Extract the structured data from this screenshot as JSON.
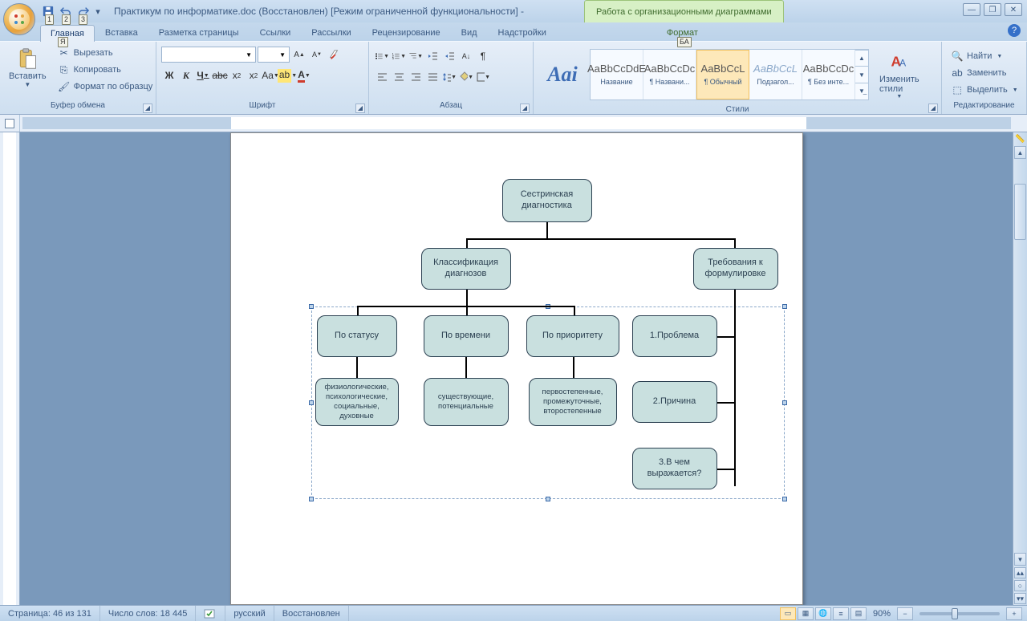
{
  "title": "Практикум по информатике.doc (Восстановлен) [Режим ограниченной функциональности] -",
  "context_tab": "Работа с организационными диаграммами",
  "qat_keytips": [
    "1",
    "2",
    "3"
  ],
  "tabs": {
    "home": "Главная",
    "insert": "Вставка",
    "page_layout": "Разметка страницы",
    "references": "Ссылки",
    "mailings": "Рассылки",
    "review": "Рецензирование",
    "view": "Вид",
    "addins": "Надстройки",
    "format": "Формат"
  },
  "tab_keytips": {
    "home": "Я",
    "format": "БА"
  },
  "clipboard": {
    "paste": "Вставить",
    "cut": "Вырезать",
    "copy": "Копировать",
    "format_painter": "Формат по образцу",
    "label": "Буфер обмена"
  },
  "font": {
    "label": "Шрифт",
    "family": "",
    "size": ""
  },
  "paragraph": {
    "label": "Абзац"
  },
  "styles": {
    "label": "Стили",
    "change": "Изменить\nстили",
    "items": [
      {
        "preview": "AaBbCcDdE",
        "name": "Название"
      },
      {
        "preview": "AaBbCcDc",
        "name": "¶ Названи..."
      },
      {
        "preview": "AaBbCcL",
        "name": "¶ Обычный"
      },
      {
        "preview": "AaBbCcL",
        "name": "Подзагол..."
      },
      {
        "preview": "AaBbCcDc",
        "name": "¶ Без инте..."
      }
    ]
  },
  "editing": {
    "label": "Редактирование",
    "find": "Найти",
    "replace": "Заменить",
    "select": "Выделить"
  },
  "status": {
    "page": "Страница: 46 из 131",
    "words": "Число слов: 18 445",
    "language": "русский",
    "recovered": "Восстановлен",
    "zoom": "90%"
  },
  "chart_data": {
    "type": "org-chart",
    "root": {
      "label": "Сестринская диагностика",
      "children": [
        {
          "label": "Классификация диагнозов",
          "children": [
            {
              "label": "По статусу",
              "children": [
                {
                  "label": "физиологические, психологические, социальные, духовные"
                }
              ]
            },
            {
              "label": "По времени",
              "children": [
                {
                  "label": "существующие, потенциальные"
                }
              ]
            },
            {
              "label": "По приоритету",
              "children": [
                {
                  "label": "первостепенные, промежуточные, второстепенные"
                }
              ]
            }
          ]
        },
        {
          "label": "Требования к формулировке",
          "children": [
            {
              "label": "1.Проблема"
            },
            {
              "label": "2.Причина"
            },
            {
              "label": "3.В чем выражается?"
            }
          ]
        }
      ]
    }
  },
  "diagram": {
    "n0": "Сестринская\nдиагностика",
    "n1": "Классификация\nдиагнозов",
    "n2": "Требования к\nформулировке",
    "n3": "По статусу",
    "n4": "По времени",
    "n5": "По приоритету",
    "n6": "физиологические,\nпсихологические,\nсоциальные,\nдуховные",
    "n7": "существующие,\nпотенциальные",
    "n8": "первостепенные,\nпромежуточные,\nвторостепенные",
    "n9": "1.Проблема",
    "n10": "2.Причина",
    "n11": "3.В чем\nвыражается?"
  }
}
